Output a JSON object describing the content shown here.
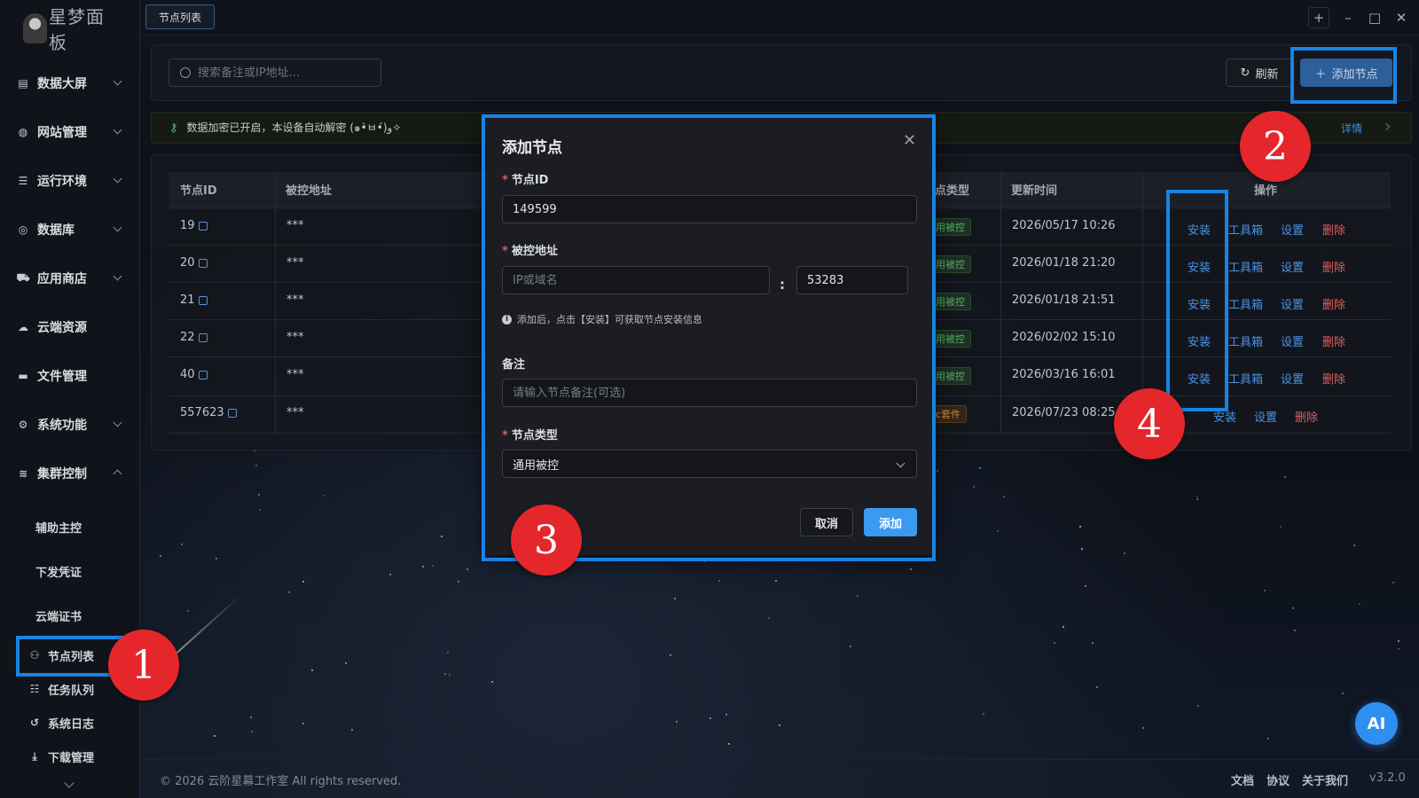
{
  "app": {
    "logo_text": "星梦面板",
    "tab_label": "节点列表"
  },
  "sidebar": {
    "groups": [
      {
        "label": "数据大屏",
        "icon": "chart-bar-icon"
      },
      {
        "label": "网站管理",
        "icon": "globe-icon"
      },
      {
        "label": "运行环境",
        "icon": "server-icon"
      },
      {
        "label": "数据库",
        "icon": "database-icon"
      },
      {
        "label": "应用商店",
        "icon": "cart-icon"
      },
      {
        "label": "云端资源",
        "icon": "cloud-icon"
      },
      {
        "label": "文件管理",
        "icon": "folder-icon"
      },
      {
        "label": "系统功能",
        "icon": "gears-icon"
      },
      {
        "label": "集群控制",
        "icon": "layers-icon"
      }
    ],
    "cluster_items": [
      "辅助主控",
      "下发凭证",
      "云端证书"
    ],
    "icon_items": [
      {
        "label": "节点列表",
        "icon": "nodes-icon"
      },
      {
        "label": "任务队列",
        "icon": "list-icon"
      },
      {
        "label": "系统日志",
        "icon": "history-icon"
      },
      {
        "label": "下载管理",
        "icon": "download-icon"
      }
    ]
  },
  "toolbar": {
    "search_placeholder": "搜索备注或IP地址...",
    "refresh_label": "刷新",
    "add_node_label": "添加节点"
  },
  "notice": {
    "text": "数据加密已开启，本设备自动解密 (๑•̀ㅂ•́)و✧",
    "detail_label": "详情"
  },
  "table": {
    "columns": [
      "节点ID",
      "被控地址",
      "点类型",
      "更新时间",
      "操作"
    ],
    "rows": [
      {
        "id": "19",
        "address": "***",
        "type": "用被控",
        "updated": "2026/05/17 10:26"
      },
      {
        "id": "20",
        "address": "***",
        "type": "用被控",
        "updated": "2026/01/18 21:20"
      },
      {
        "id": "21",
        "address": "***",
        "type": "用被控",
        "updated": "2026/01/18 21:51"
      },
      {
        "id": "22",
        "address": "***",
        "type": "用被控",
        "updated": "2026/02/02 15:10"
      },
      {
        "id": "40",
        "address": "***",
        "type": "用被控",
        "updated": "2026/03/16 16:01"
      },
      {
        "id": "557623",
        "address": "***",
        "type": "c套件",
        "updated": "2026/07/23 08:25"
      }
    ],
    "actions": {
      "install": "安装",
      "toolbox": "工具箱",
      "settings": "设置",
      "delete": "删除"
    }
  },
  "modal": {
    "title": "添加节点",
    "node_id_label": "节点ID",
    "node_id_value": "149599",
    "address_label": "被控地址",
    "host_placeholder": "IP或域名",
    "colon": ":",
    "port_value": "53283",
    "hint": "添加后，点击【安装】可获取节点安装信息",
    "note_label": "备注",
    "note_placeholder": "请输入节点备注(可选)",
    "type_label": "节点类型",
    "type_value": "通用被控",
    "cancel_label": "取消",
    "add_label": "添加"
  },
  "steps": [
    "1",
    "2",
    "3",
    "4"
  ],
  "footer": {
    "copyright": "© 2026 云阶星幕工作室 All rights reserved.",
    "links": [
      "文档",
      "协议",
      "关于我们"
    ],
    "version": "v3.2.0"
  },
  "ai_label": "AI",
  "colors": {
    "accent": "#1784e6",
    "primary_button": "#3a9af0",
    "danger": "#e35d5d",
    "badge": "#e5262b"
  }
}
